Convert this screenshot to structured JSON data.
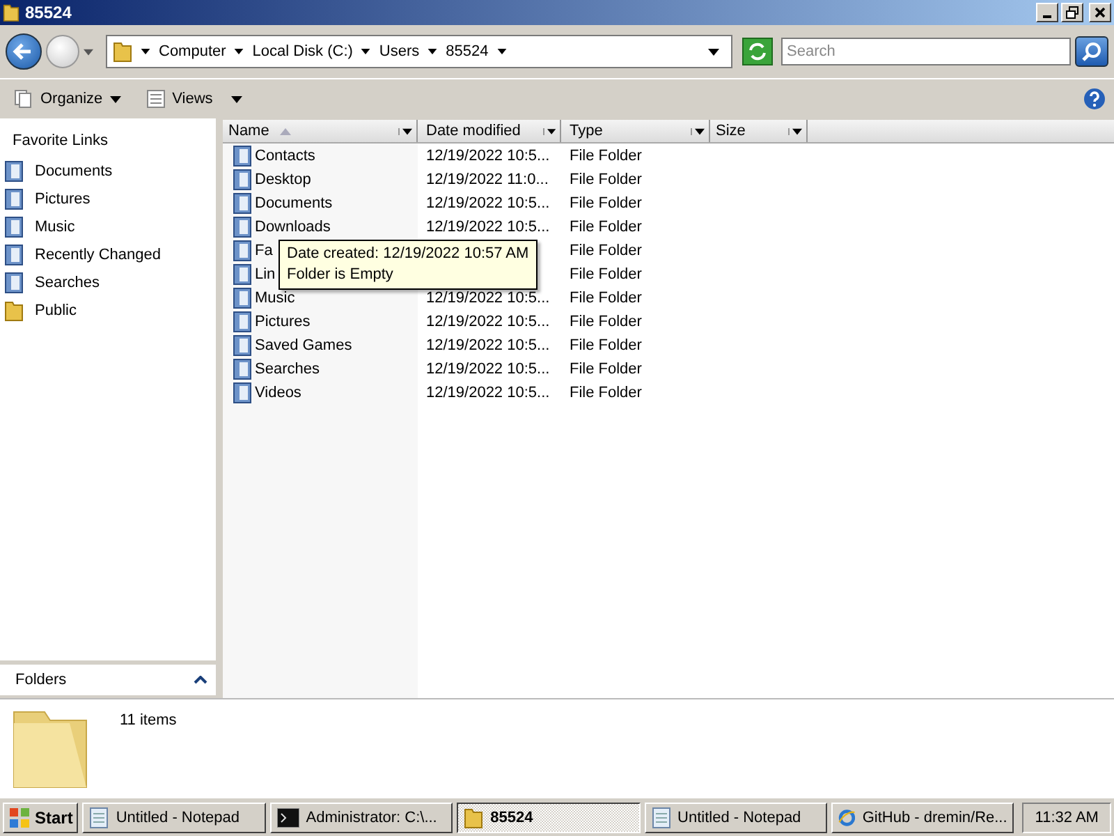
{
  "window": {
    "title": "85524"
  },
  "breadcrumb": [
    "Computer",
    "Local Disk (C:)",
    "Users",
    "85524"
  ],
  "search": {
    "placeholder": "Search"
  },
  "toolbar": [
    "Organize",
    "Views"
  ],
  "sidebar": {
    "heading": "Favorite Links",
    "items": [
      {
        "label": "Documents",
        "kind": "special"
      },
      {
        "label": "Pictures",
        "kind": "special"
      },
      {
        "label": "Music",
        "kind": "special"
      },
      {
        "label": "Recently Changed",
        "kind": "special"
      },
      {
        "label": "Searches",
        "kind": "special"
      },
      {
        "label": "Public",
        "kind": "folder"
      }
    ],
    "folders_label": "Folders"
  },
  "table": {
    "columns": [
      {
        "label": "Name",
        "sorted": true
      },
      {
        "label": "Date modified",
        "sorted": false
      },
      {
        "label": "Type",
        "sorted": false
      },
      {
        "label": "Size",
        "sorted": false
      }
    ],
    "rows": [
      {
        "name": "Contacts",
        "date_modified": "12/19/2022 10:5...",
        "type": "File Folder"
      },
      {
        "name": "Desktop",
        "date_modified": "12/19/2022 11:0...",
        "type": "File Folder"
      },
      {
        "name": "Documents",
        "date_modified": "12/19/2022 10:5...",
        "type": "File Folder"
      },
      {
        "name": "Downloads",
        "date_modified": "12/19/2022 10:5...",
        "type": "File Folder"
      },
      {
        "name": "Fa",
        "type": "File Folder"
      },
      {
        "name": "Lin",
        "type": "File Folder"
      },
      {
        "name": "Music",
        "date_modified": "12/19/2022 10:5...",
        "type": "File Folder"
      },
      {
        "name": "Pictures",
        "date_modified": "12/19/2022 10:5...",
        "type": "File Folder"
      },
      {
        "name": "Saved Games",
        "date_modified": "12/19/2022 10:5...",
        "type": "File Folder"
      },
      {
        "name": "Searches",
        "date_modified": "12/19/2022 10:5...",
        "type": "File Folder"
      },
      {
        "name": "Videos",
        "date_modified": "12/19/2022 10:5...",
        "type": "File Folder"
      }
    ]
  },
  "tooltip": {
    "lines": [
      "Date created: 12/19/2022 10:57 AM",
      "Folder is Empty"
    ]
  },
  "details": {
    "count": "11 items"
  },
  "taskbar": {
    "start": "Start",
    "buttons": [
      {
        "label": "Untitled - Notepad",
        "kind": "notepad",
        "selected": false
      },
      {
        "label": "Administrator: C:\\...",
        "kind": "console",
        "selected": false
      },
      {
        "label": "85524",
        "kind": "folder",
        "selected": true
      },
      {
        "label": "Untitled - Notepad",
        "kind": "notepad",
        "selected": false
      },
      {
        "label": "GitHub - dremin/Re...",
        "kind": "browser",
        "selected": false
      }
    ],
    "clock": "11:32 AM"
  }
}
